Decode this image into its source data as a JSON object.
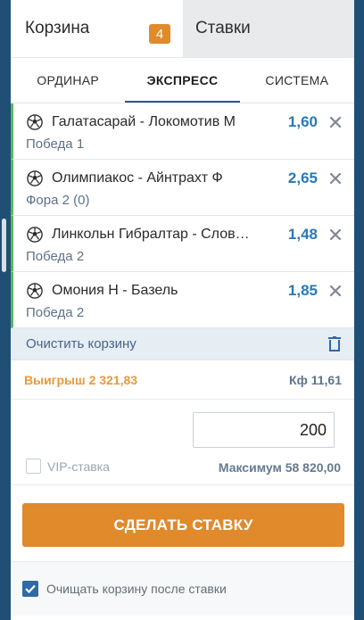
{
  "top_tabs": {
    "cart_label": "Корзина",
    "cart_count": "4",
    "bets_label": "Ставки"
  },
  "bet_types": [
    "ОРДИНАР",
    "ЭКСПРЕСС",
    "СИСТЕМА"
  ],
  "active_bet_type": "ЭКСПРЕСС",
  "events": [
    {
      "name": "Галатасарай - Локомотив М",
      "outcome": "Победа 1",
      "odds": "1,60"
    },
    {
      "name": "Олимпиакос - Айнтрахт Ф",
      "outcome": "Фора 2 (0)",
      "odds": "2,65"
    },
    {
      "name": "Линкольн Гибралтар - Слов…",
      "outcome": "Победа 2",
      "odds": "1,48"
    },
    {
      "name": "Омония Н - Базель",
      "outcome": "Победа 2",
      "odds": "1,85"
    }
  ],
  "clear_cart_label": "Очистить корзину",
  "summary": {
    "win_label": "Выигрыш 2 321,83",
    "coef_label": "Кф 11,61"
  },
  "stake": {
    "value": "200",
    "vip_label": "VIP-ставка",
    "maximum_label": "Максимум 58 820,00"
  },
  "submit_label": "СДЕЛАТЬ СТАВКУ",
  "clear_after_label": "Очищать корзину после ставки",
  "colors": {
    "accent_orange": "#e08a2c",
    "odds_blue": "#2a79b5",
    "event_border_green": "#5cb85c",
    "page_background": "#1f4f74"
  },
  "icons": {
    "event": "soccer-ball-icon",
    "remove": "close-icon",
    "clear": "trash-icon",
    "checkbox_checked": "checkmark-icon"
  }
}
